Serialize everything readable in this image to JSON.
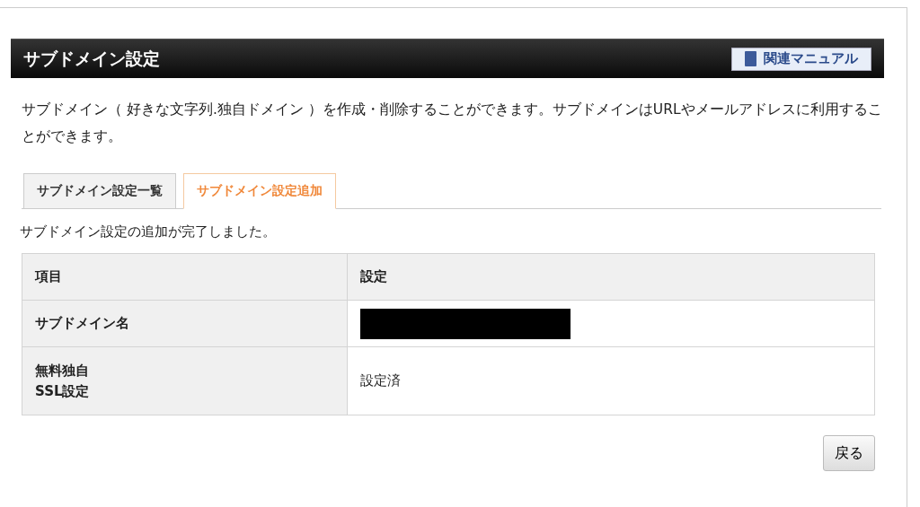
{
  "header": {
    "title": "サブドメイン設定",
    "manual_button": "関連マニュアル"
  },
  "description": "サブドメイン（ 好きな文字列.独自ドメイン ）を作成・削除することができます。サブドメインはURLやメールアドレスに利用することができます。",
  "tabs": [
    {
      "label": "サブドメイン設定一覧",
      "selected": false
    },
    {
      "label": "サブドメイン設定追加",
      "selected": true
    }
  ],
  "message": "サブドメイン設定の追加が完了しました。",
  "table": {
    "columns": [
      "項目",
      "設定"
    ],
    "rows": [
      {
        "label": "サブドメイン名",
        "redacted": true
      },
      {
        "label": "無料独自\nSSL設定",
        "value": "設定済"
      }
    ]
  },
  "back_button": "戻る"
}
